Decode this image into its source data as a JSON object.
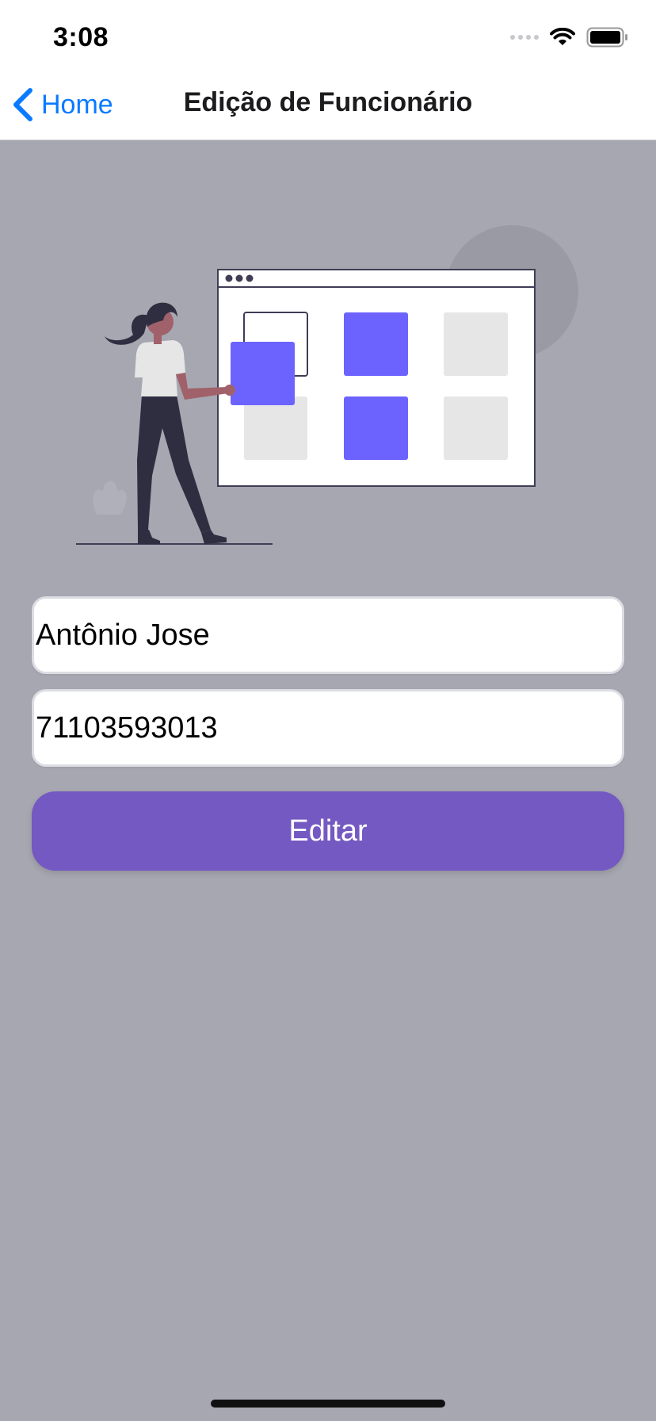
{
  "status_bar": {
    "time": "3:08",
    "icons": [
      "cellular-signal-icon",
      "wifi-icon",
      "battery-icon"
    ]
  },
  "nav": {
    "back_label": "Home",
    "back_icon": "chevron-left-icon",
    "title": "Edição de Funcionário"
  },
  "form": {
    "name_value": "Antônio Jose",
    "phone_value": "71103593013",
    "submit_label": "Editar"
  },
  "colors": {
    "background": "#a7a7b1",
    "accent": "#7459c2",
    "link": "#0a7aff",
    "illustration_accent": "#6c63ff"
  }
}
